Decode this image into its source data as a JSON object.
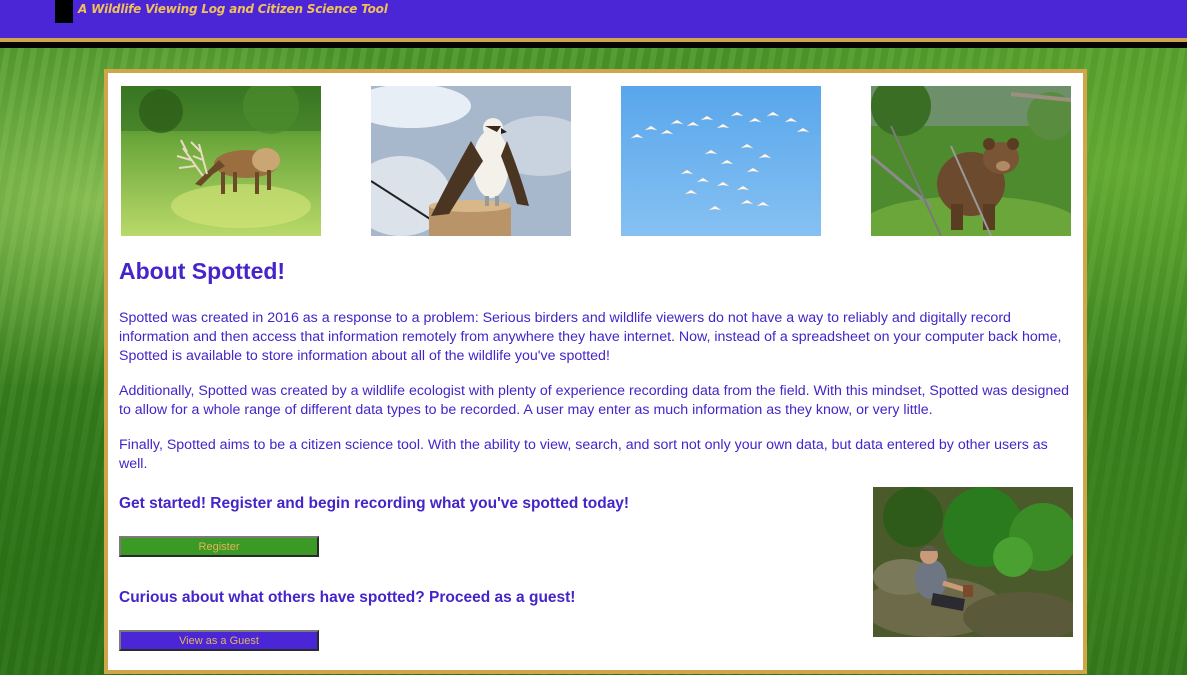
{
  "header": {
    "tagline": "A Wildlife Viewing Log and Citizen Science Tool",
    "background_color": "#4a26d6",
    "accent_color": "#d1a64a"
  },
  "gallery": [
    {
      "name": "elk-photo",
      "subject": "elk grazing"
    },
    {
      "name": "osprey-photo",
      "subject": "osprey on post"
    },
    {
      "name": "birds-photo",
      "subject": "flock of birds in sky"
    },
    {
      "name": "bear-photo",
      "subject": "black bear in meadow"
    }
  ],
  "about": {
    "title": "About Spotted!",
    "paragraphs": [
      "Spotted was created in 2016 as a response to a problem: Serious birders and wildlife viewers do not have a way to reliably and digitally record information and then access that information remotely from anywhere they have internet. Now, instead of a spreadsheet on your computer back home, Spotted is available to store information about all of the wildlife you've spotted!",
      "Additionally, Spotted was created by a wildlife ecologist with plenty of experience recording data from the field. With this mindset, Spotted was designed to allow for a whole range of different data types to be recorded. A user may enter as much information as they know, or very little.",
      "Finally, Spotted aims to be a citizen science tool. With the ability to view, search, and sort not only your own data, but data entered by other users as well."
    ],
    "text_color": "#4524c9"
  },
  "register": {
    "heading": "Get started! Register and begin recording what you've spotted today!",
    "button_label": "Register",
    "button_color": "#3a9a25"
  },
  "guest": {
    "heading": "Curious about what others have spotted? Proceed as a guest!",
    "button_label": "View as a Guest",
    "button_color": "#4a26d6"
  },
  "side_photo": {
    "name": "field-researcher-photo",
    "subject": "person sitting among rocks and plants"
  }
}
